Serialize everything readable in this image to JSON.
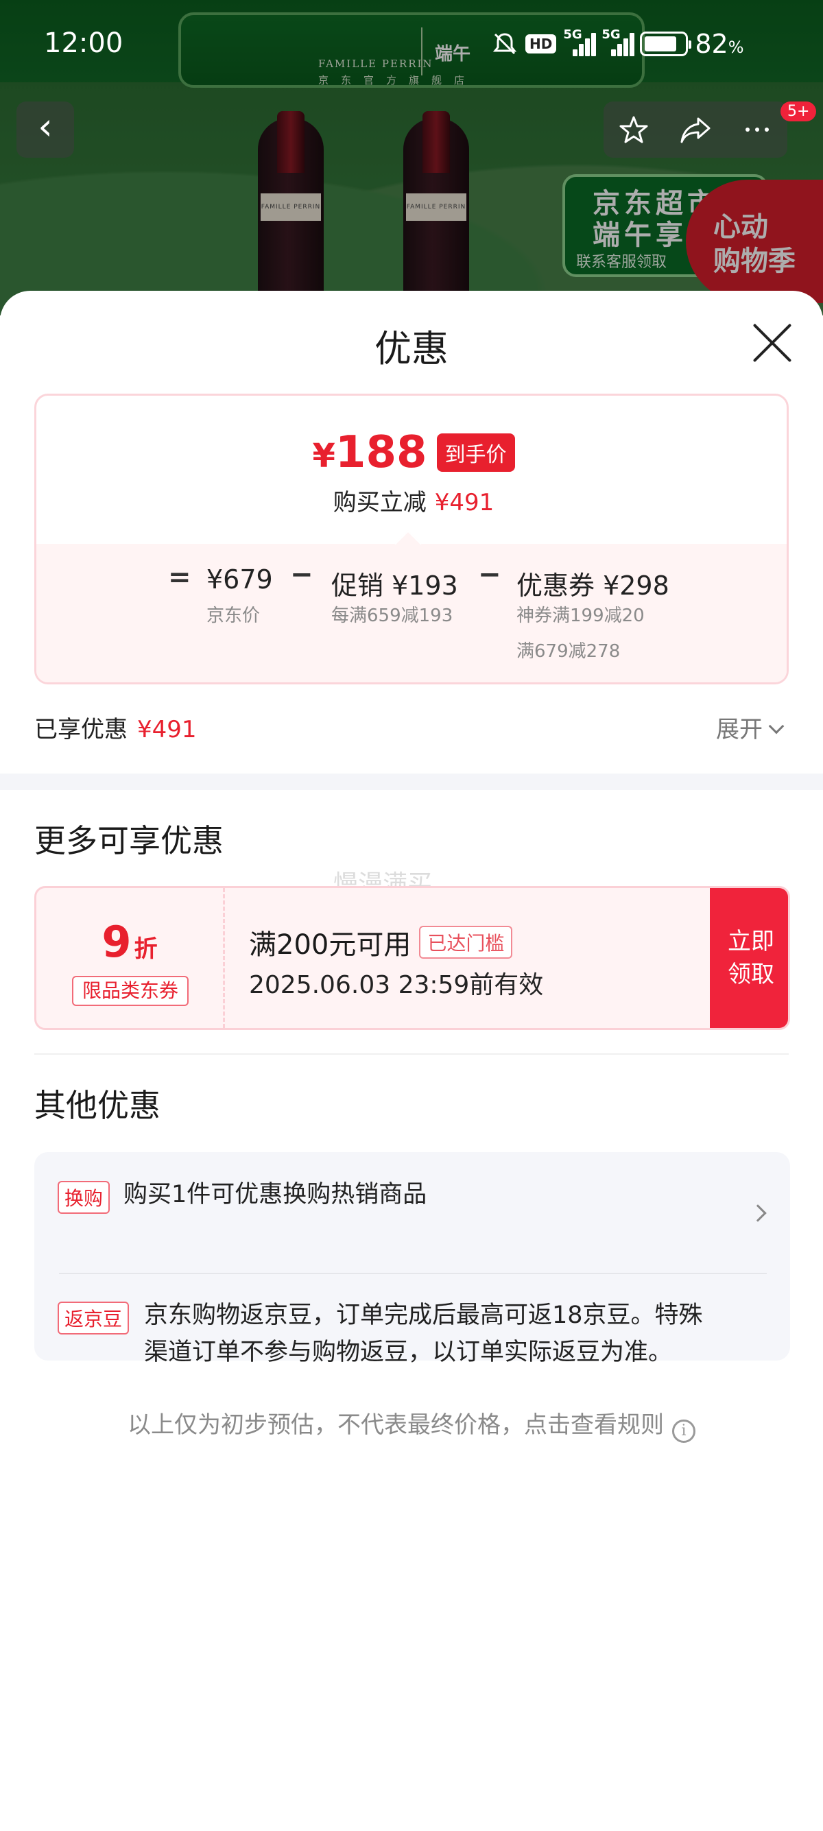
{
  "status_bar": {
    "time": "12:00",
    "hd_label": "HD",
    "net1": "5G",
    "net2": "5G",
    "battery_percent": "82",
    "battery_unit": "%"
  },
  "background_page": {
    "store_name": "FAMILLE PERRIN",
    "store_subtitle": "京东官方旗舰店",
    "store_right_text": "端午",
    "bottle_label": "FAMILLE PERRIN",
    "promo_line1": "京东超市",
    "promo_line2": "端午享惠",
    "promo_line3": "联系客服领取",
    "festival_line1": "心动",
    "festival_line2": "购物季",
    "notification_badge": "5+"
  },
  "sheet": {
    "title": "优惠",
    "price_card": {
      "currency": "¥",
      "final_price": "188",
      "final_tag": "到手价",
      "discount_label": "购买立减",
      "discount_amount": "¥491",
      "equals": "=",
      "minus": "−",
      "jd_price": "¥679",
      "jd_price_label": "京东价",
      "promo_value": "促销 ¥193",
      "promo_desc": "每满659减193",
      "coupon_value": "优惠券 ¥298",
      "coupon_desc_1": "神券满199减20",
      "coupon_desc_2": "满679减278"
    },
    "enjoyed_label": "已享优惠",
    "enjoyed_amount": "¥491",
    "expand_label": "展开",
    "more_title": "更多可享优惠",
    "watermark": "慢漫满买",
    "coupon": {
      "value": "9",
      "unit": "折",
      "type_label": "限品类东券",
      "condition": "满200元可用",
      "status_badge": "已达门槛",
      "expiry": "2025.06.03 23:59前有效",
      "btn_line1": "立即",
      "btn_line2": "领取"
    },
    "other_title": "其他优惠",
    "other_items": [
      {
        "tag": "换购",
        "text": "购买1件可优惠换购热销商品"
      },
      {
        "tag": "返京豆",
        "text_line1": "京东购物返京豆，订单完成后最高可返18京豆。特殊",
        "text_line2": "渠道订单不参与购物返豆，以订单实际返豆为准。"
      }
    ],
    "footer_note": "以上仅为初步预估，不代表最终价格，点击查看规则",
    "info_glyph": "i"
  },
  "colors": {
    "accent_red": "#e8202e",
    "button_red": "#f0233b",
    "background_green": "#156b2a"
  }
}
